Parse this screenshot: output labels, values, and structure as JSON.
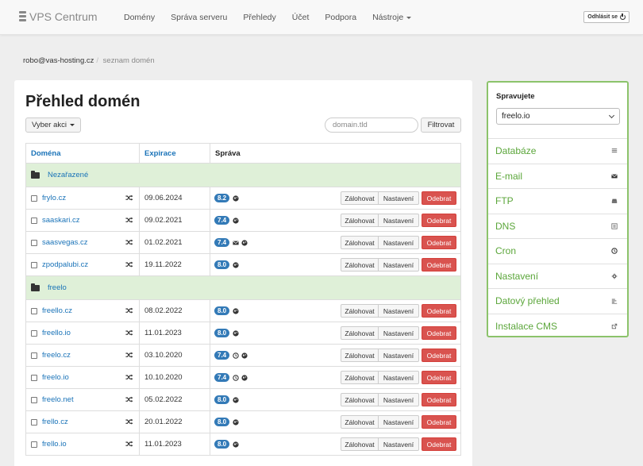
{
  "brand": "VPS Centrum",
  "nav": [
    "Domény",
    "Správa serveru",
    "Přehledy",
    "Účet",
    "Podpora",
    "Nástroje"
  ],
  "logout_label": "Odhlásit se",
  "breadcrumb": {
    "user": "robo@vas-hosting.cz",
    "current": "seznam domén"
  },
  "main": {
    "title": "Přehled domén",
    "actions_label": "Vyber akci",
    "filter_placeholder": "domain.tld",
    "filter_button": "Filtrovat",
    "columns": [
      "Doména",
      "Expirace",
      "Správa"
    ],
    "buttons": {
      "backup": "Zálohovat",
      "settings": "Nastavení",
      "remove": "Odebrat"
    },
    "groups": [
      {
        "name": "Nezařazené",
        "rows": [
          {
            "domain": "frylo.cz",
            "expiry": "09.06.2024",
            "php": "8.2",
            "icons": [
              "globe-icon"
            ]
          },
          {
            "domain": "saaskari.cz",
            "expiry": "09.02.2021",
            "php": "7.4",
            "icons": [
              "globe-icon"
            ]
          },
          {
            "domain": "saasvegas.cz",
            "expiry": "01.02.2021",
            "php": "7.4",
            "icons": [
              "mail-icon",
              "globe-icon"
            ]
          },
          {
            "domain": "zpodpalubi.cz",
            "expiry": "19.11.2022",
            "php": "8.0",
            "icons": [
              "globe-icon"
            ]
          }
        ]
      },
      {
        "name": "freelo",
        "rows": [
          {
            "domain": "freello.cz",
            "expiry": "08.02.2022",
            "php": "8.0",
            "icons": [
              "globe-icon"
            ]
          },
          {
            "domain": "freello.io",
            "expiry": "11.01.2023",
            "php": "8.0",
            "icons": [
              "globe-icon"
            ]
          },
          {
            "domain": "freelo.cz",
            "expiry": "03.10.2020",
            "php": "7.4",
            "icons": [
              "clock-icon",
              "globe-icon"
            ]
          },
          {
            "domain": "freelo.io",
            "expiry": "10.10.2020",
            "php": "7.4",
            "icons": [
              "clock-icon",
              "globe-icon"
            ]
          },
          {
            "domain": "freelo.net",
            "expiry": "05.02.2022",
            "php": "8.0",
            "icons": [
              "globe-icon"
            ]
          },
          {
            "domain": "frello.cz",
            "expiry": "20.01.2022",
            "php": "8.0",
            "icons": [
              "globe-icon"
            ]
          },
          {
            "domain": "frello.io",
            "expiry": "11.01.2023",
            "php": "8.0",
            "icons": [
              "globe-icon"
            ]
          }
        ]
      }
    ]
  },
  "sidebar": {
    "title": "Spravujete",
    "selected_domain": "freelo.io",
    "items": [
      {
        "label": "Databáze",
        "icon": "database-icon"
      },
      {
        "label": "E-mail",
        "icon": "mail-icon"
      },
      {
        "label": "FTP",
        "icon": "drive-icon"
      },
      {
        "label": "DNS",
        "icon": "list-icon"
      },
      {
        "label": "Cron",
        "icon": "clock-icon"
      },
      {
        "label": "Nastavení",
        "icon": "gear-icon"
      },
      {
        "label": "Datový přehled",
        "icon": "chart-icon"
      },
      {
        "label": "Instalace CMS",
        "icon": "external-icon"
      }
    ]
  },
  "colors": {
    "accent_green": "#8cc36b",
    "link": "#1a73b8",
    "badge": "#337ab7",
    "danger": "#d9534f",
    "group_bg": "#dff0d8"
  }
}
